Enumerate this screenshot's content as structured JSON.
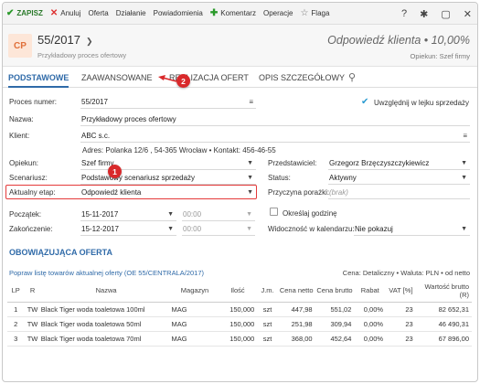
{
  "toolbar": {
    "save": "ZAPISZ",
    "cancel": "Anuluj",
    "items": [
      "Oferta",
      "Działanie",
      "Powiadomienia"
    ],
    "comment": "Komentarz",
    "operations": "Operacje",
    "flag": "Flaga",
    "right_icons": [
      "?",
      "✱",
      "▢",
      "✕"
    ]
  },
  "header": {
    "badge": "CP",
    "title": "55/2017",
    "subtitle": "Przykładowy proces ofertowy",
    "stage": "Odpowiedź klienta • 10,00%",
    "owner": "Opiekun: Szef firmy"
  },
  "tabs": [
    "PODSTAWOWE",
    "ZAAWANSOWANE",
    "REALIZACJA OFERT",
    "OPIS SZCZEGÓŁOWY"
  ],
  "form": {
    "process_number_label": "Proces numer:",
    "process_number": "55/2017",
    "include_label": "Uwzględnij w lejku sprzedaży",
    "name_label": "Nazwa:",
    "name": "Przykładowy proces ofertowy",
    "client_label": "Klient:",
    "client": "ABC s.c.",
    "address": "Adres: Polanka 12/6 , 54-365 Wrocław  •  Kontakt: 456-46-55",
    "owner_label": "Opiekun:",
    "owner": "Szef firmy",
    "representative_label": "Przedstawiciel:",
    "representative": "Grzegorz Brzęczyszczykiewicz",
    "scenario_label": "Scenariusz:",
    "scenario": "Podstawowy scenariusz sprzedaży",
    "status_label": "Status:",
    "status": "Aktywny",
    "stage_label": "Aktualny etap:",
    "stage": "Odpowiedź klienta",
    "loss_reason_label": "Przyczyna porażki:",
    "loss_reason": "(brak)",
    "start_label": "Początek:",
    "start_date": "15-11-2017",
    "start_time": "00:00",
    "end_label": "Zakończenie:",
    "end_date": "15-12-2017",
    "end_time": "00:00",
    "specify_time_label": "Określaj godzinę",
    "calendar_label": "Widoczność w kalendarzu:",
    "calendar": "Nie pokazuj"
  },
  "offer": {
    "section_title": "OBOWIĄZUJĄCA OFERTA",
    "link": "Popraw listę towarów aktualnej oferty (OE 55/CENTRALA/2017)",
    "summary": "Cena: Detaliczny • Waluta: PLN • od netto",
    "columns": [
      "LP",
      "R",
      "Nazwa",
      "Magazyn",
      "Ilość",
      "J.m.",
      "Cena netto",
      "Cena brutto",
      "Rabat",
      "VAT [%]",
      "Wartość brutto (R)"
    ],
    "rows": [
      [
        "1",
        "TW",
        "Black Tiger woda toaletowa 100ml",
        "MAG",
        "150,000",
        "szt",
        "447,98",
        "551,02",
        "0,00%",
        "23",
        "82 652,31"
      ],
      [
        "2",
        "TW",
        "Black Tiger woda toaletowa 50ml",
        "MAG",
        "150,000",
        "szt",
        "251,98",
        "309,94",
        "0,00%",
        "23",
        "46 490,31"
      ],
      [
        "3",
        "TW",
        "Black Tiger woda toaletowa 70ml",
        "MAG",
        "150,000",
        "szt",
        "368,00",
        "452,64",
        "0,00%",
        "23",
        "67 896,00"
      ]
    ]
  },
  "callouts": [
    "1",
    "2"
  ],
  "colors": {
    "accent": "#2f6aa8",
    "highlight": "#e43a3a",
    "badge_bg": "#fde6d8",
    "badge_fg": "#e0703a"
  }
}
